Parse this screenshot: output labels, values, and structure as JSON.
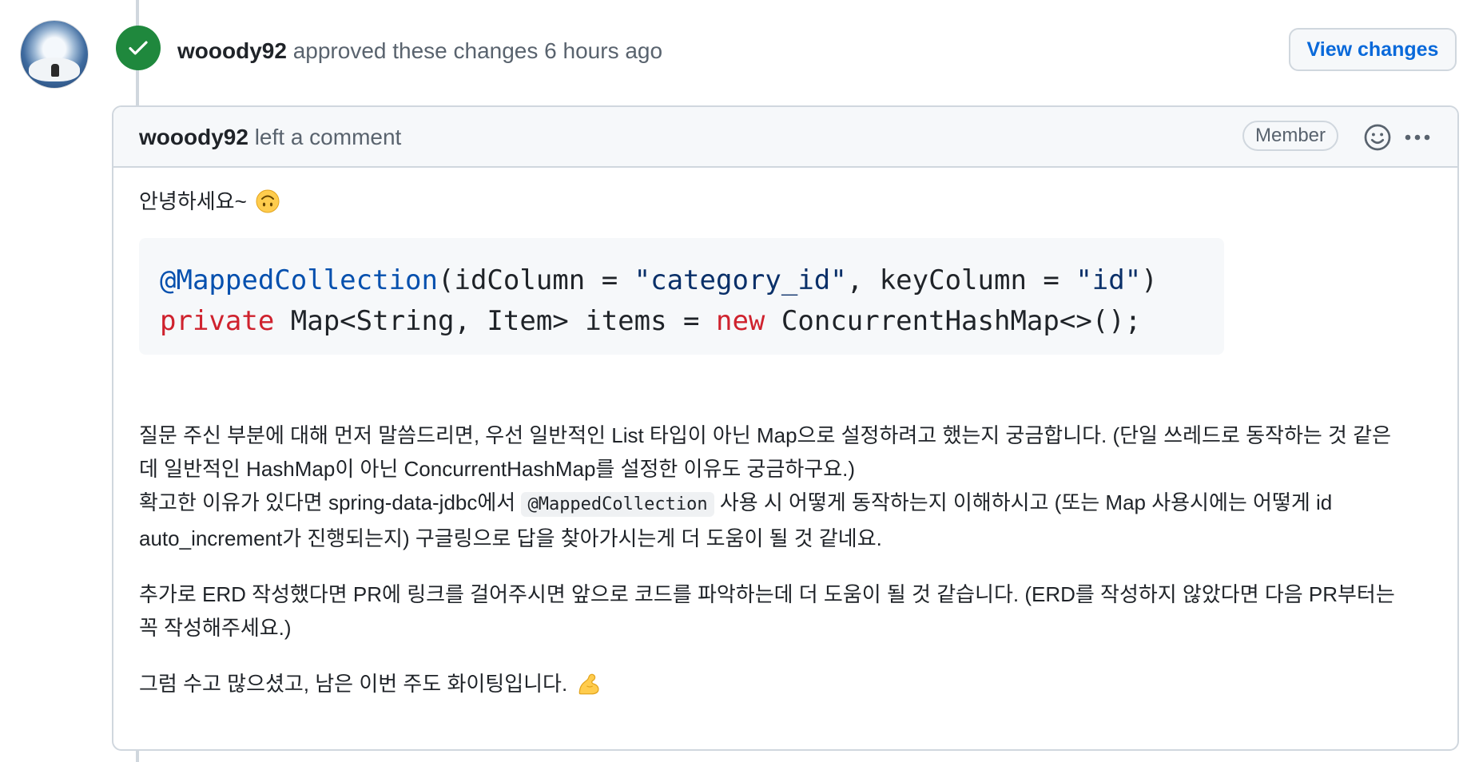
{
  "review_event": {
    "author": "wooody92",
    "action": "approved these changes",
    "time": "6 hours ago",
    "view_changes_label": "View changes"
  },
  "comment": {
    "author": "wooody92",
    "action": "left a comment",
    "role_badge": "Member",
    "greeting": "안녕하세요~",
    "code_lines": [
      [
        "@MappedCollection",
        "(idColumn = ",
        "\"category_id\"",
        ", keyColumn = ",
        "\"id\"",
        ")"
      ],
      [
        "private",
        " Map<String, Item> items = ",
        "new",
        " ConcurrentHashMap<>();"
      ]
    ],
    "paragraph1": {
      "line1": "질문 주신 부분에 대해 먼저 말씀드리면, 우선 일반적인 List 타입이 아닌 Map으로 설정하려고 했는지 궁금합니다. (단일 쓰레드로 동작하는 것 같은",
      "line2": "데 일반적인 HashMap이 아닌 ConcurrentHashMap를 설정한 이유도 궁금하구요.)",
      "line3_before": "확고한 이유가 있다면 spring-data-jdbc에서 ",
      "line3_code": "@MappedCollection",
      "line3_after": " 사용 시 어떻게 동작하는지 이해하시고 (또는 Map 사용시에는 어떻게 id",
      "line4": "auto_increment가 진행되는지) 구글링으로 답을 찾아가시는게 더 도움이 될 것 같네요."
    },
    "paragraph2": {
      "line1": "추가로 ERD 작성했다면 PR에 링크를 걸어주시면 앞으로 코드를 파악하는데 더 도움이 될 것 같습니다. (ERD를 작성하지 않았다면 다음 PR부터는",
      "line2": "꼭 작성해주세요.)"
    },
    "paragraph3": "그럼 수고 많으셨고, 남은 이번 주도 화이팅입니다."
  },
  "icons": {
    "approved": "check-icon",
    "reaction": "smiley-icon",
    "more": "kebab-horizontal-icon",
    "greeting_emoji": "upside-down-face-icon",
    "closing_emoji": "flexed-biceps-icon"
  },
  "colors": {
    "approved_green": "#1f883d",
    "link_blue": "#0969da",
    "muted_text": "#59636e",
    "border": "#d0d7de",
    "code_bg": "#f6f8fa",
    "keyword_red": "#cf222e",
    "annotation_blue": "#0550ae",
    "string_navy": "#0a3069"
  }
}
